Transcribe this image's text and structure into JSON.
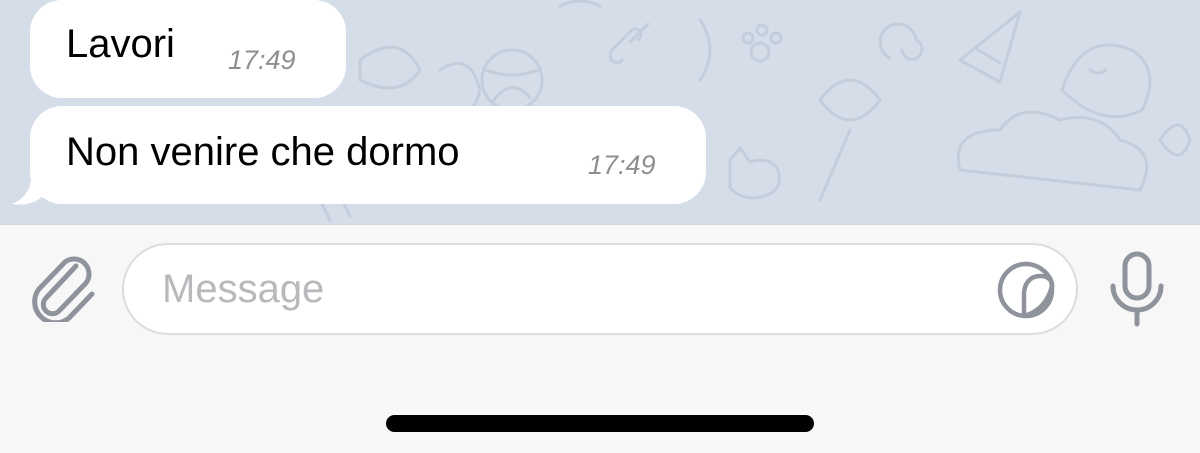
{
  "messages": [
    {
      "text": "Lavori",
      "time": "17:49"
    },
    {
      "text": "Non venire che dormo",
      "time": "17:49"
    }
  ],
  "composer": {
    "placeholder": "Message"
  },
  "icons": {
    "attach": "paperclip-icon",
    "sticker": "sticker-icon",
    "mic": "microphone-icon"
  },
  "colors": {
    "chat_background": "#d5dde8",
    "bubble": "#ffffff",
    "icon_gray": "#8e939c"
  }
}
